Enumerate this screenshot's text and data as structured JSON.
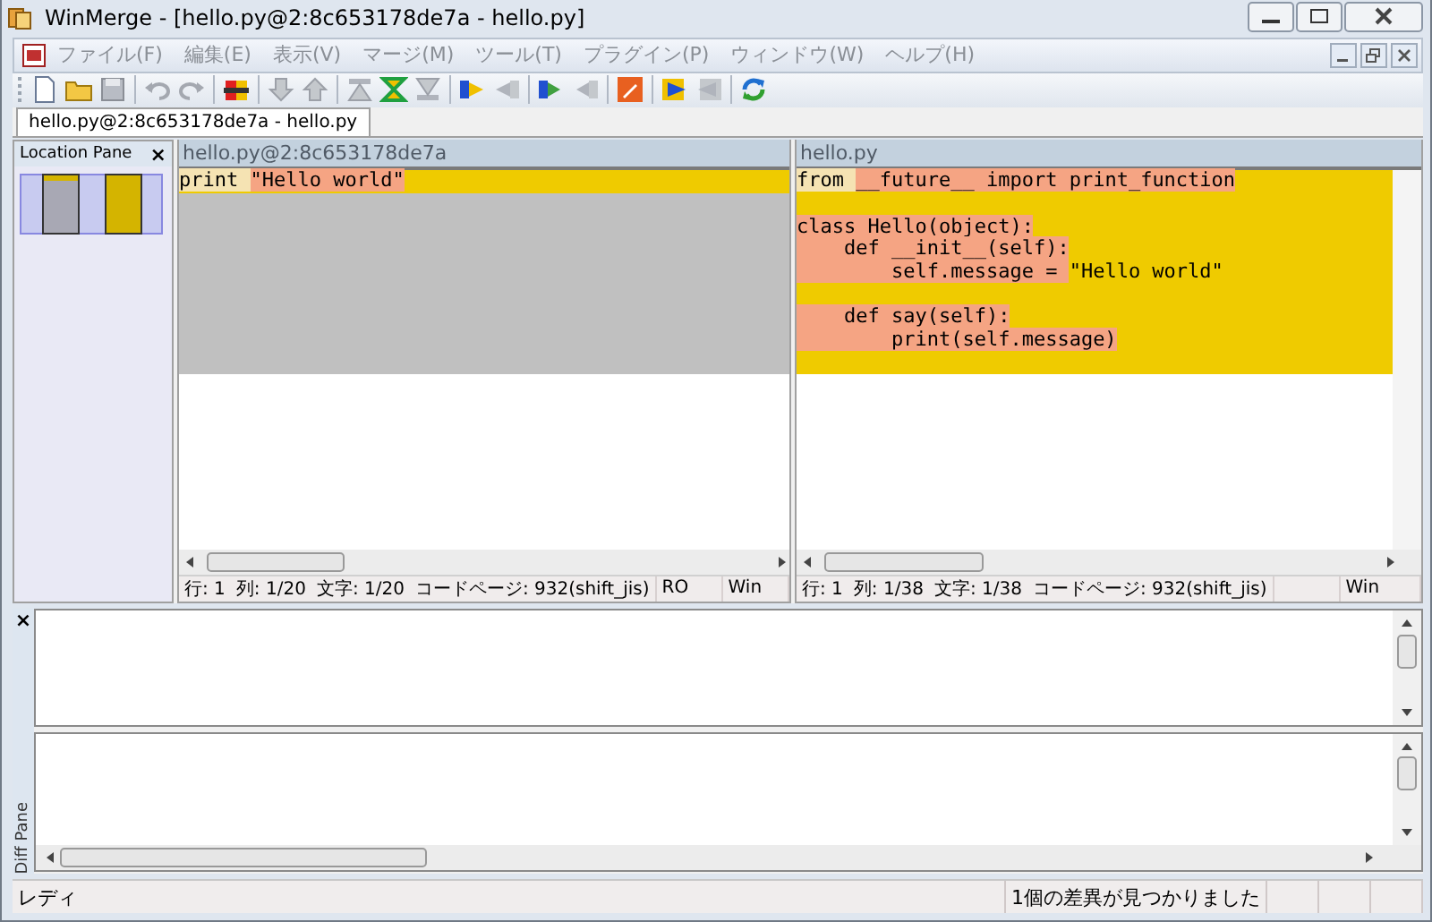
{
  "window": {
    "title": "WinMerge - [hello.py@2:8c653178de7a - hello.py]"
  },
  "menu": [
    "ファイル(F)",
    "編集(E)",
    "表示(V)",
    "マージ(M)",
    "ツール(T)",
    "プラグイン(P)",
    "ウィンドウ(W)",
    "ヘルプ(H)"
  ],
  "tabs": [
    {
      "label": "hello.py@2:8c653178de7a - hello.py",
      "selected": true
    }
  ],
  "location_pane": {
    "title": "Location Pane",
    "close": "×"
  },
  "panes": [
    {
      "title": "hello.py@2:8c653178de7a",
      "lines": [
        {
          "kind": "changed",
          "segments": [
            {
              "text": "print ",
              "kind": "same"
            },
            {
              "text": "\"Hello world\"",
              "kind": "changed"
            }
          ]
        },
        {
          "kind": "missing"
        },
        {
          "kind": "missing"
        },
        {
          "kind": "missing"
        },
        {
          "kind": "missing"
        },
        {
          "kind": "missing"
        },
        {
          "kind": "missing"
        },
        {
          "kind": "missing"
        },
        {
          "kind": "missing"
        }
      ],
      "status": {
        "position": [
          "行: 1",
          "列: 1/20",
          "文字: 1/20",
          "コードページ: 932(shift_jis)"
        ],
        "mode": "RO",
        "eol": "Win"
      }
    },
    {
      "title": "hello.py",
      "lines": [
        {
          "kind": "changed",
          "segments": [
            {
              "text": "from ",
              "kind": "same"
            },
            {
              "text": "__future__ import print_function",
              "kind": "changed"
            }
          ]
        },
        {
          "kind": "changed"
        },
        {
          "kind": "changed",
          "segments": [
            {
              "text": "class Hello(object):",
              "kind": "changed"
            }
          ]
        },
        {
          "kind": "changed",
          "segments": [
            {
              "text": "    def __init__(self):",
              "kind": "changed"
            }
          ]
        },
        {
          "kind": "changed",
          "segments": [
            {
              "text": "        self.message = ",
              "kind": "changed"
            },
            {
              "text": "\"Hello world\"",
              "kind": "plain"
            }
          ]
        },
        {
          "kind": "changed"
        },
        {
          "kind": "changed",
          "segments": [
            {
              "text": "    def say(self):",
              "kind": "changed"
            }
          ]
        },
        {
          "kind": "changed",
          "segments": [
            {
              "text": "        print(self.message)",
              "kind": "changed"
            }
          ]
        },
        {
          "kind": "changed"
        }
      ],
      "status": {
        "position": [
          "行: 1",
          "列: 1/38",
          "文字: 1/38",
          "コードページ: 932(shift_jis)"
        ],
        "eol": "Win"
      }
    }
  ],
  "diff_pane": {
    "label": "Diff Pane",
    "close": "×"
  },
  "status_bar": {
    "state": "レディ",
    "message": "1個の差異が見つかりました"
  }
}
